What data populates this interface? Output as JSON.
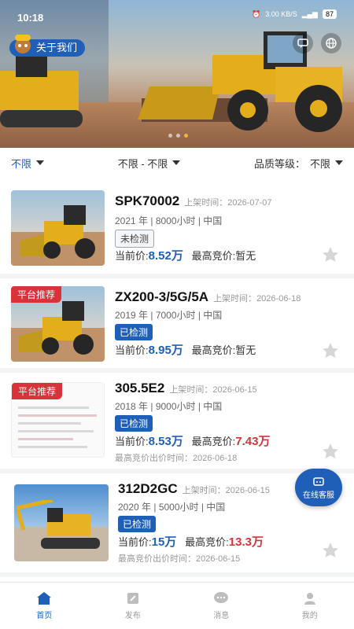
{
  "status": {
    "time": "10:18",
    "net_speed": "3.00 KB/S",
    "battery": "87"
  },
  "banner": {
    "about_label": "关于我们"
  },
  "filters": {
    "region": "不限",
    "range": "不限 - 不限",
    "quality_label": "品质等级：",
    "quality_value": "不限"
  },
  "listings": [
    {
      "name": "SPK70002",
      "listed_label": "上架时间：",
      "date": "2026-07-07",
      "meta": "2021 年 | 8000小时 | 中国",
      "inspect": "未检测",
      "price_label": "当前价:",
      "price": "8.52万",
      "bid_label": "最高竞价:",
      "bid": "暂无"
    },
    {
      "badge": "平台推荐",
      "name": "ZX200-3/5G/5A",
      "listed_label": "上架时间：",
      "date": "2026-06-18",
      "meta": "2019 年 | 7000小时 | 中国",
      "inspect": "已检测",
      "price_label": "当前价:",
      "price": "8.95万",
      "bid_label": "最高竞价:",
      "bid": "暂无"
    },
    {
      "badge": "平台推荐",
      "name": "305.5E2",
      "listed_label": "上架时间：",
      "date": "2026-06-15",
      "meta": "2018 年 | 9000小时 | 中国",
      "inspect": "已检测",
      "price_label": "当前价:",
      "price": "8.53万",
      "bid_label": "最高竞价:",
      "bid": "7.43万",
      "bid_time_label": "最高竞价出价时间：",
      "bid_time": "2026-06-18"
    },
    {
      "name": "312D2GC",
      "listed_label": "上架时间：",
      "date": "2026-06-15",
      "meta": "2020 年 | 5000小时 | 中国",
      "inspect": "已检测",
      "price_label": "当前价:",
      "price": "15万",
      "bid_label": "最高竞价:",
      "bid": "13.3万",
      "bid_time_label": "最高竞价出价时间：",
      "bid_time": "2026-06-15"
    }
  ],
  "service": {
    "label": "在线客服"
  },
  "tabs": [
    {
      "label": "首页",
      "icon": "home-icon"
    },
    {
      "label": "发布",
      "icon": "edit-icon"
    },
    {
      "label": "消息",
      "icon": "message-icon"
    },
    {
      "label": "我的",
      "icon": "user-icon"
    }
  ],
  "colors": {
    "primary": "#1f5fb8",
    "accent_red": "#d8323a"
  }
}
